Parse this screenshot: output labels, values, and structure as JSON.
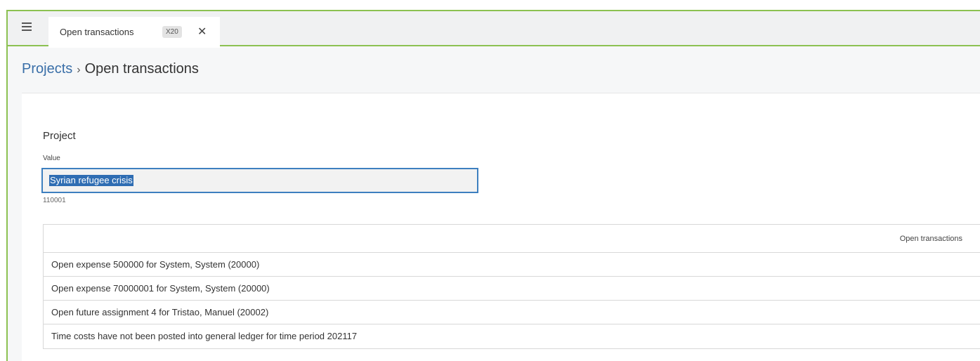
{
  "tab": {
    "title": "Open transactions",
    "badge": "X20"
  },
  "breadcrumb": {
    "parent": "Projects",
    "separator": "›",
    "current": "Open transactions"
  },
  "section": {
    "title": "Project"
  },
  "field": {
    "label": "Value",
    "value": "Syrian refugee crisis",
    "sub": "110001"
  },
  "grid": {
    "column_header": "Open transactions",
    "rows": [
      "Open expense 500000 for System, System (20000)",
      "Open expense 70000001 for System, System (20000)",
      "Open future assignment 4 for Tristao, Manuel (20002)",
      "Time costs have not been posted into general ledger for time period 202117"
    ]
  },
  "colors": {
    "accent_green": "#8cc152",
    "link_blue": "#3a6fa8",
    "focus_blue": "#3d7fbf"
  }
}
